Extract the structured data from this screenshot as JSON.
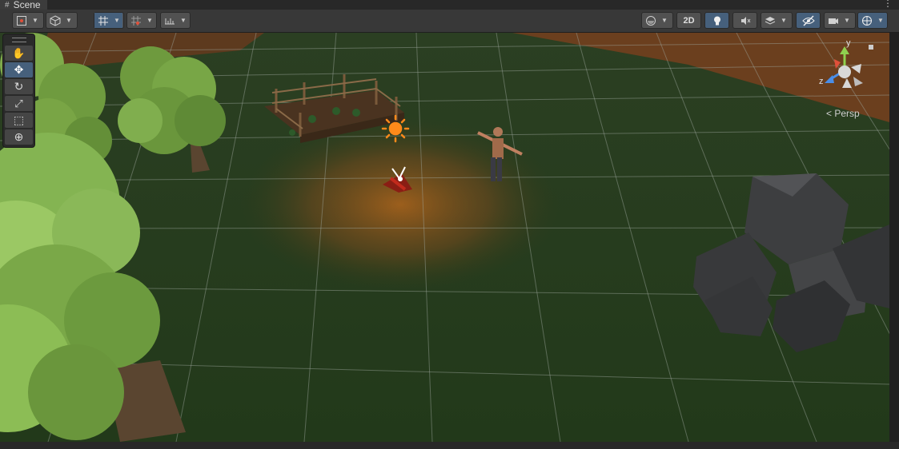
{
  "window": {
    "tab_title": "Scene",
    "tab_icon": "grid-hash-icon",
    "menu_icon": "⋮"
  },
  "toolbar": {
    "left_groups": [
      {
        "name": "draw-mode",
        "icon": "gizmo-draw-icon"
      },
      {
        "name": "render-mode",
        "icon": "cube-icon"
      },
      {
        "name": "grid-snap",
        "icon": "grid-snap-icon",
        "active": true
      },
      {
        "name": "increment-snap",
        "icon": "snap-increment-icon"
      },
      {
        "name": "ruler",
        "icon": "ruler-icon"
      }
    ],
    "two_d_label": "2D",
    "right_groups": [
      {
        "name": "shading",
        "icon": "sphere-icon"
      },
      {
        "name": "lighting",
        "icon": "lightbulb-icon",
        "active": true
      },
      {
        "name": "audio",
        "icon": "audio-mute-icon"
      },
      {
        "name": "effects",
        "icon": "layers-icon"
      },
      {
        "name": "hidden-objects",
        "icon": "eye-slash-icon",
        "active": true
      },
      {
        "name": "camera",
        "icon": "camera-icon"
      },
      {
        "name": "gizmos",
        "icon": "gizmo-globe-icon",
        "active": true
      }
    ]
  },
  "tools_overlay": {
    "tools": [
      {
        "name": "hand-tool",
        "glyph": "✋",
        "selected": false
      },
      {
        "name": "move-tool",
        "glyph": "✥",
        "selected": true
      },
      {
        "name": "rotate-tool",
        "glyph": "↻",
        "selected": false
      },
      {
        "name": "scale-tool",
        "glyph": "⤢",
        "selected": false
      },
      {
        "name": "rect-tool",
        "glyph": "⬚",
        "selected": false
      },
      {
        "name": "transform-tool",
        "glyph": "⊕",
        "selected": false
      }
    ]
  },
  "orientation_gizmo": {
    "y_label": "y",
    "z_label": "z",
    "projection_label": "Persp"
  },
  "colors": {
    "accent": "#46607c",
    "ground": "#233a1c",
    "dirt": "#6b3f1e",
    "tree_light": "#8cbd55",
    "rock": "#3d3e40",
    "light_gizmo": "#ff8a1a"
  }
}
